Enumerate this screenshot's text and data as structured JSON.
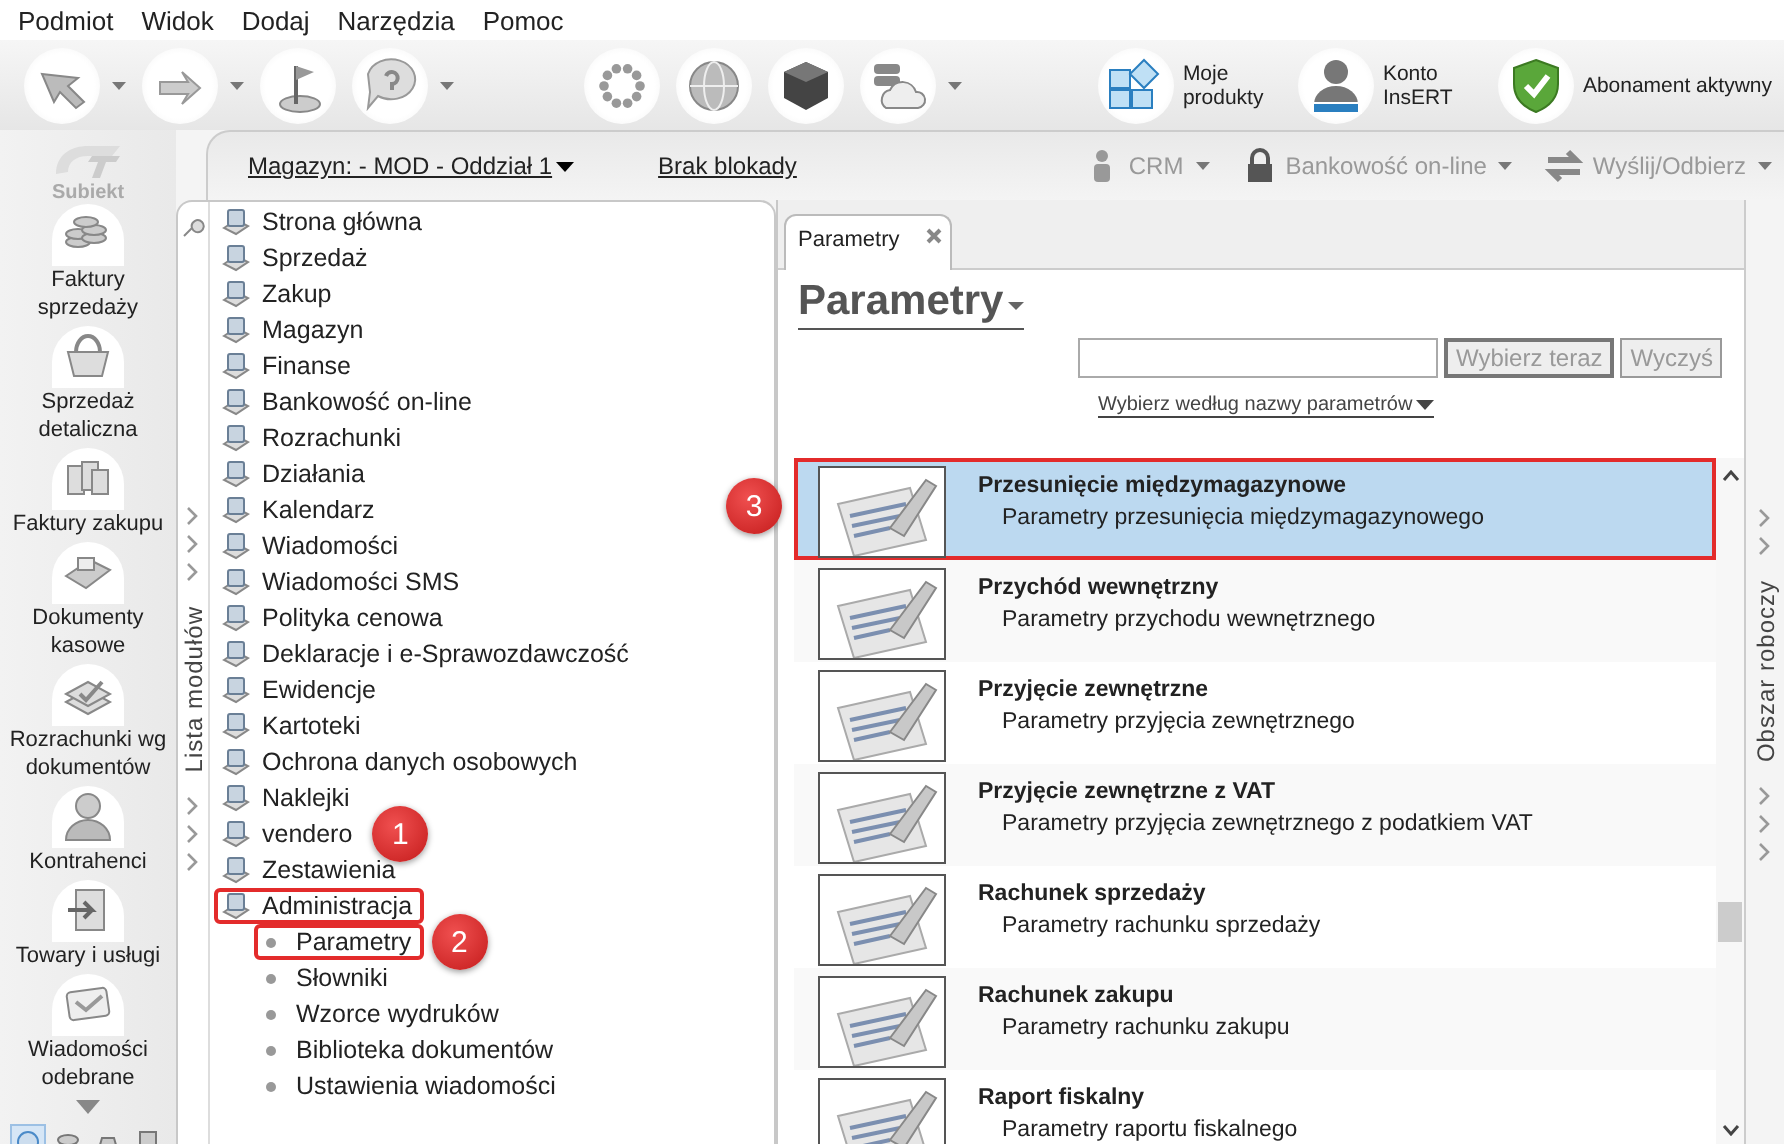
{
  "menu": [
    "Podmiot",
    "Widok",
    "Dodaj",
    "Narzędzia",
    "Pomoc"
  ],
  "toolbar": {
    "left_buttons": [
      {
        "dropdown": true
      },
      {
        "dropdown": true
      },
      {
        "dropdown": false
      },
      {
        "dropdown": true
      }
    ],
    "center_buttons": [
      {
        "dropdown": false
      },
      {
        "dropdown": false
      },
      {
        "dropdown": false
      },
      {
        "dropdown": true
      }
    ],
    "right_buttons": [
      {
        "label": "Moje produkty"
      },
      {
        "label": "Konto InsERT"
      },
      {
        "label": "Abonament aktywny"
      }
    ]
  },
  "nav_bar": {
    "warehouse": "Magazyn: - MOD - Oddział 1",
    "lock": "Brak blokady",
    "actions": [
      {
        "label": "CRM"
      },
      {
        "label": "Bankowość on-line"
      },
      {
        "label": "Wyślij/Odbierz"
      }
    ]
  },
  "left_nav": {
    "logo": "Subiekt",
    "items": [
      "Faktury sprzedaży",
      "Sprzedaż detaliczna",
      "Faktury zakupu",
      "Dokumenty kasowe",
      "Rozrachunki wg dokumentów",
      "Kontrahenci",
      "Towary i usługi",
      "Wiadomości odebrane"
    ],
    "bottom_tabs": [
      {
        "selected": true
      },
      {
        "selected": false
      },
      {
        "selected": false
      },
      {
        "selected": false
      }
    ]
  },
  "modules": {
    "title": "Lista modułów",
    "items": [
      {
        "label": "Strona główna"
      },
      {
        "label": "Sprzedaż"
      },
      {
        "label": "Zakup"
      },
      {
        "label": "Magazyn"
      },
      {
        "label": "Finanse"
      },
      {
        "label": "Bankowość on-line"
      },
      {
        "label": "Rozrachunki"
      },
      {
        "label": "Działania"
      },
      {
        "label": "Kalendarz"
      },
      {
        "label": "Wiadomości"
      },
      {
        "label": "Wiadomości SMS"
      },
      {
        "label": "Polityka cenowa"
      },
      {
        "label": "Deklaracje i e-Sprawozdawczość"
      },
      {
        "label": "Ewidencje"
      },
      {
        "label": "Kartoteki"
      },
      {
        "label": "Ochrona danych osobowych"
      },
      {
        "label": "Naklejki"
      },
      {
        "label": "vendero",
        "callout": "1"
      },
      {
        "label": "Zestawienia"
      },
      {
        "label": "Administracja",
        "outlined": true,
        "children": [
          {
            "label": "Parametry",
            "outlined": true,
            "callout": "2"
          },
          {
            "label": "Słowniki"
          },
          {
            "label": "Wzorce wydruków"
          },
          {
            "label": "Biblioteka dokumentów"
          },
          {
            "label": "Ustawienia wiadomości"
          }
        ]
      }
    ]
  },
  "tabs": [
    {
      "label": "Parametry",
      "selected": true
    }
  ],
  "page": {
    "title": "Parametry",
    "buttons": [
      "Wybierz teraz",
      "Wyczyś"
    ],
    "filter": "Wybierz według nazwy parametrów"
  },
  "list": [
    {
      "title": "Przesunięcie międzymagazynowe",
      "subtitle": "Parametry przesunięcia międzymagazynowego",
      "selected": true,
      "outlined": true,
      "callout": "3"
    },
    {
      "title": "Przychód wewnętrzny",
      "subtitle": "Parametry przychodu wewnętrznego",
      "selected": false
    },
    {
      "title": "Przyjęcie zewnętrzne",
      "subtitle": "Parametry przyjęcia zewnętrznego",
      "selected": false
    },
    {
      "title": "Przyjęcie zewnętrzne z VAT",
      "subtitle": "Parametry przyjęcia zewnętrznego z podatkiem VAT",
      "selected": false
    },
    {
      "title": "Rachunek sprzedaży",
      "subtitle": "Parametry rachunku sprzedaży",
      "selected": false
    },
    {
      "title": "Rachunek zakupu",
      "subtitle": "Parametry rachunku zakupu",
      "selected": false
    },
    {
      "title": "Raport fiskalny",
      "subtitle": "Parametry raportu fiskalnego",
      "selected": false
    }
  ],
  "right_panel": {
    "title": "Obszar roboczy"
  }
}
